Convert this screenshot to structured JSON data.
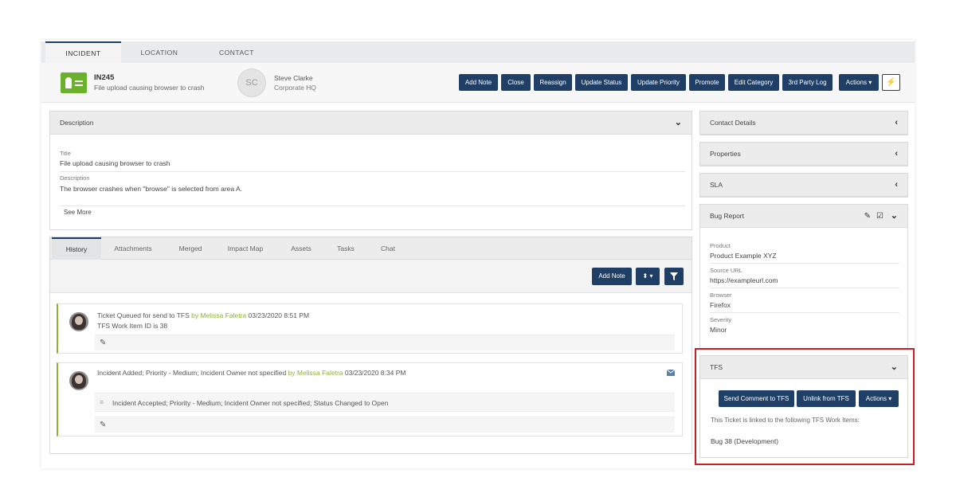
{
  "tabs": [
    "INCIDENT",
    "LOCATION",
    "CONTACT"
  ],
  "incident": {
    "id": "IN245",
    "subtitle": "File upload causing browser to crash"
  },
  "contact": {
    "initials": "SC",
    "name": "Steve Clarke",
    "org": "Corporate HQ"
  },
  "toolbar": {
    "buttons": [
      "Add Note",
      "Close",
      "Reassign",
      "Update Status",
      "Update Priority",
      "Promote",
      "Edit Category",
      "3rd Party Log",
      "Actions ▾"
    ],
    "bolt_icon": "⚡"
  },
  "description_panel": {
    "heading": "Description",
    "title_label": "Title",
    "title_value": "File upload causing browser to crash",
    "desc_label": "Description",
    "desc_value": "The browser crashes when \"browse\" is selected from area A.",
    "see_more": "See More"
  },
  "history": {
    "tabs": [
      "History",
      "Attachments",
      "Merged",
      "Impact Map",
      "Assets",
      "Tasks",
      "Chat"
    ],
    "add_note_label": "Add Note",
    "sort_label": "⬍ ▾",
    "filter_icon": "filter-icon",
    "entries": [
      {
        "text": "Ticket Queued for send to TFS",
        "by": "by Melissa Faletra",
        "time": "03/23/2020 8:51 PM",
        "line2": "TFS Work Item ID is 38"
      },
      {
        "text": "Incident Added; Priority - Medium; Incident Owner not specified",
        "by": "by Melissa Faletra",
        "time": "03/23/2020 8:34 PM",
        "sub": "Incident Accepted; Priority - Medium; Incident Owner not specified; Status Changed to Open"
      }
    ]
  },
  "side": {
    "contact_details": "Contact Details",
    "properties": "Properties",
    "sla": "SLA",
    "bug_report": {
      "heading": "Bug Report",
      "fields": [
        {
          "label": "Product",
          "value": "Product Example XYZ"
        },
        {
          "label": "Source URL",
          "value": "https://exampleurl.com"
        },
        {
          "label": "Browser",
          "value": "Firefox"
        },
        {
          "label": "Severity",
          "value": "Minor"
        }
      ]
    },
    "tfs": {
      "heading": "TFS",
      "send_label": "Send Comment to TFS",
      "unlink_label": "Unlink from TFS",
      "actions_label": "Actions ▾",
      "linked_text": "This Ticket is linked to the following TFS Work Items:",
      "item": "Bug 38 (Development)"
    }
  },
  "colors": {
    "accent": "#1f3f66",
    "green": "#6bb12b",
    "highlight": "#c62128"
  }
}
